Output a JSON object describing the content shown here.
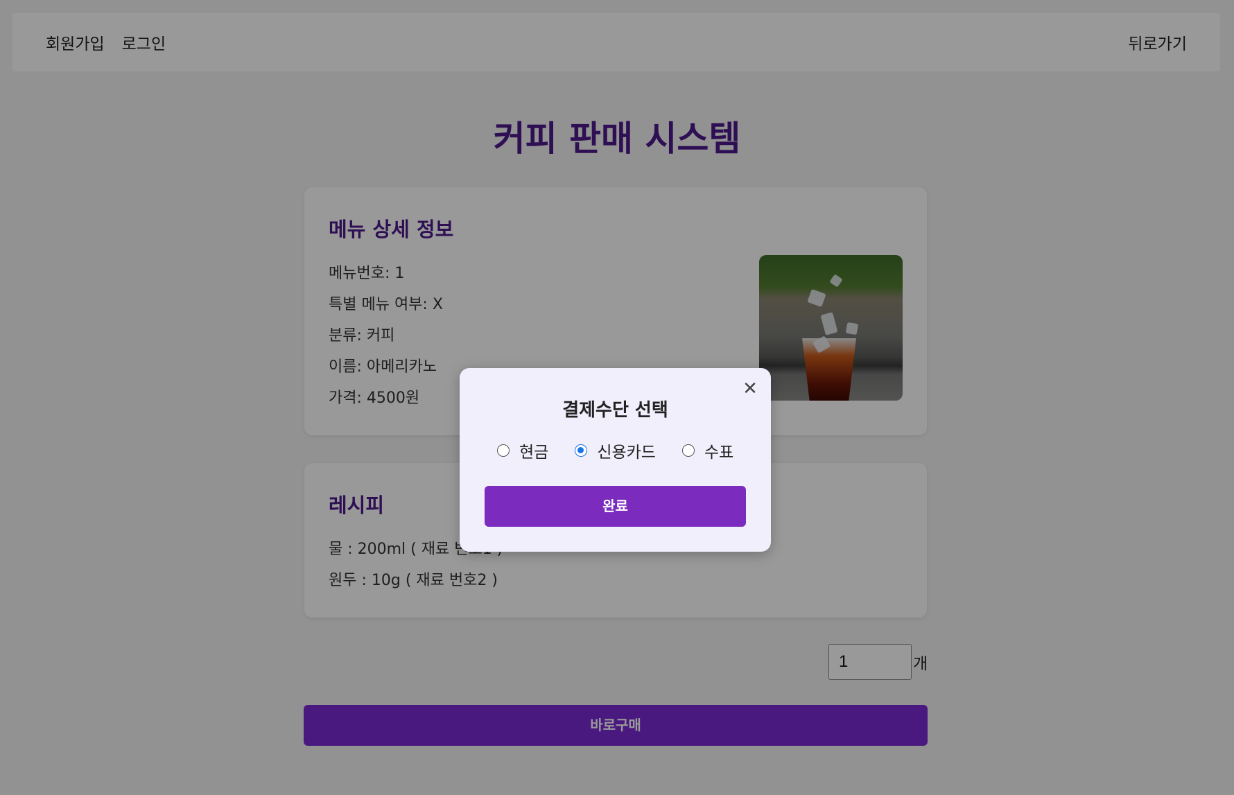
{
  "header": {
    "signup_label": "회원가입",
    "login_label": "로그인",
    "back_label": "뒤로가기"
  },
  "page_title": "커피 판매 시스템",
  "detail": {
    "heading": "메뉴 상세 정보",
    "menu_no": "메뉴번호: 1",
    "special": "특별 메뉴 여부: X",
    "category": "분류: 커피",
    "name": "이름: 아메리카노",
    "price": "가격: 4500원"
  },
  "recipe": {
    "heading": "레시피",
    "items": [
      "물 : 200ml ( 재료 번호1 )",
      "원두 : 10g ( 재료 번호2 )"
    ]
  },
  "quantity": {
    "value": "1",
    "unit": "개"
  },
  "buy_label": "바로구매",
  "modal": {
    "title": "결제수단 선택",
    "close_icon": "close-icon",
    "options": [
      {
        "label": "현금",
        "checked": false
      },
      {
        "label": "신용카드",
        "checked": true
      },
      {
        "label": "수표",
        "checked": false
      }
    ],
    "complete_label": "완료"
  },
  "colors": {
    "accent": "#7b2cbf",
    "title": "#4d1a8c",
    "radio_selected": "#1a73e8"
  }
}
